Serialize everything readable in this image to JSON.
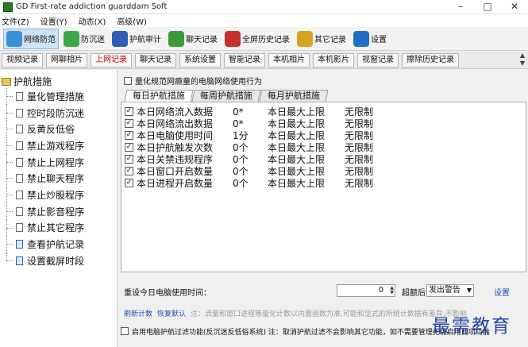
{
  "window": {
    "title": "GD First-rate addiction guarddam Soft",
    "minimize": "–",
    "maximize": "□",
    "close": "✕"
  },
  "menu": [
    "文件(Z)",
    "设置(Y)",
    "动态(X)",
    "高级(W)"
  ],
  "toolbar": [
    {
      "label": "网络防范",
      "icon": "shield-network-icon",
      "color": "#3a8fd6",
      "active": true
    },
    {
      "label": "防沉迷",
      "icon": "leaf-icon",
      "color": "#3aa845",
      "active": false
    },
    {
      "label": "护航审计",
      "icon": "book-icon",
      "color": "#2d5fb5",
      "active": false
    },
    {
      "label": "聊天记录",
      "icon": "chat-icon",
      "color": "#3c9a3c",
      "active": false
    },
    {
      "label": "全屏历史记录",
      "icon": "history-icon",
      "color": "#c9302c",
      "active": false
    },
    {
      "label": "其它记录",
      "icon": "person-icon",
      "color": "#d7a21e",
      "active": false
    },
    {
      "label": "设置",
      "icon": "wifi-icon",
      "color": "#1f6fc2",
      "active": false
    }
  ],
  "tabs": [
    {
      "label": "视频记录",
      "selected": false
    },
    {
      "label": "网聊相片",
      "selected": false
    },
    {
      "label": "上网记录",
      "selected": true
    },
    {
      "label": "聊天记录",
      "selected": false
    },
    {
      "label": "系统设置",
      "selected": false
    },
    {
      "label": "智能记录",
      "selected": false
    },
    {
      "label": "本机相片",
      "selected": false
    },
    {
      "label": "本机影片",
      "selected": false
    },
    {
      "label": "视窗记录",
      "selected": false
    },
    {
      "label": "擦除历史记录",
      "selected": false
    }
  ],
  "sidebar": {
    "root": "护航措施",
    "items": [
      {
        "label": "量化管理措施",
        "icon": "doc-icon"
      },
      {
        "label": "控时段防沉迷",
        "icon": "doc-icon"
      },
      {
        "label": "反黄反低俗",
        "icon": "doc-icon"
      },
      {
        "label": "禁止游戏程序",
        "icon": "doc-icon"
      },
      {
        "label": "禁止上网程序",
        "icon": "doc-icon"
      },
      {
        "label": "禁止聊天程序",
        "icon": "doc-icon"
      },
      {
        "label": "禁止炒股程序",
        "icon": "doc-icon"
      },
      {
        "label": "禁止影音程序",
        "icon": "doc-icon"
      },
      {
        "label": "禁止其它程序",
        "icon": "doc-icon"
      },
      {
        "label": "查看护航记录",
        "icon": "arrow-doc-icon"
      },
      {
        "label": "设置截屏时段",
        "icon": "arrow-doc-icon"
      }
    ]
  },
  "main": {
    "quantify_checkbox": "量化规范网瘾童的电脑网络使用行为",
    "subtabs": [
      {
        "label": "每日护航措施",
        "selected": true
      },
      {
        "label": "每周护航措施",
        "selected": false
      },
      {
        "label": "每月护航措施",
        "selected": false
      }
    ],
    "rows": [
      {
        "name": "本日网络流入数据",
        "value": "0*",
        "limit": "本日最大上限",
        "status": "无限制",
        "checked": true
      },
      {
        "name": "本日网络流出数据",
        "value": "0*",
        "limit": "本日最大上限",
        "status": "无限制",
        "checked": true
      },
      {
        "name": "本日电脑使用时间",
        "value": "1分",
        "limit": "本日最大上限",
        "status": "无限制",
        "checked": true
      },
      {
        "name": "本日护航触发次数",
        "value": "0个",
        "limit": "本日最大上限",
        "status": "无限制",
        "checked": true
      },
      {
        "name": "本日关禁违规程序",
        "value": "0个",
        "limit": "本日最大上限",
        "status": "无限制",
        "checked": true
      },
      {
        "name": "本日窗口开启数量",
        "value": "0个",
        "limit": "本日最大上限",
        "status": "无限制",
        "checked": true
      },
      {
        "name": "本日进程开启数量",
        "value": "0个",
        "limit": "本日最大上限",
        "status": "无限制",
        "checked": true
      }
    ],
    "reset_label": "重设今日电脑使用时间：",
    "reset_value": "0",
    "after_label": "超额后",
    "action_option": "发出警告",
    "set_link": "设置",
    "refresh_link": "刷新计数",
    "restore_link": "恢复默认",
    "note": "注：流量和窗口进程等量化计数以内置函数为准,可能和显式的所统计数据有差异,不影响",
    "enable_checkbox": "启用电脑护航过滤功能(反沉迷反低俗系统)  注：取消护航过滤不会影响其它功能，如不需要管理无需启用此项功能"
  },
  "watermark": "最需教育"
}
